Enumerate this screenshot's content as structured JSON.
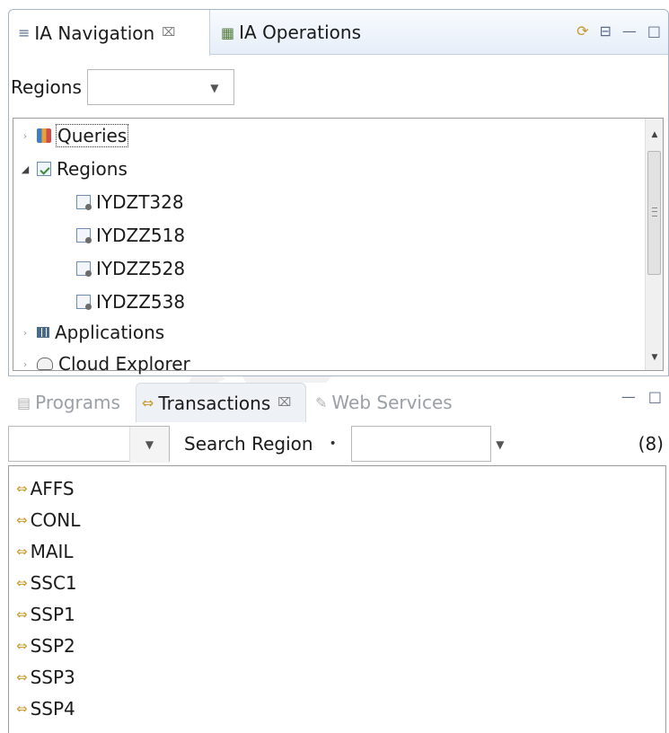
{
  "navigation_view": {
    "tabs": [
      {
        "label": "IA Navigation",
        "active": true
      },
      {
        "label": "IA Operations",
        "active": false
      }
    ],
    "filter_label": "Regions",
    "filter_value": "",
    "tree": [
      {
        "label": "Queries",
        "level": 0,
        "expanded": false,
        "icon": "queries-icon"
      },
      {
        "label": "Regions",
        "level": 0,
        "expanded": true,
        "icon": "regions-icon"
      },
      {
        "label": "IYDZT328",
        "level": 1,
        "icon": "region-icon"
      },
      {
        "label": "IYDZZ518",
        "level": 1,
        "icon": "region-icon"
      },
      {
        "label": "IYDZZ528",
        "level": 1,
        "icon": "region-icon"
      },
      {
        "label": "IYDZZ538",
        "level": 1,
        "icon": "region-icon"
      },
      {
        "label": "Applications",
        "level": 0,
        "expanded": false,
        "icon": "applications-icon"
      },
      {
        "label": "Cloud Explorer",
        "level": 0,
        "expanded": false,
        "icon": "cloud-icon"
      }
    ]
  },
  "transactions_view": {
    "tabs": [
      {
        "label": "Programs",
        "active": false
      },
      {
        "label": "Transactions",
        "active": true
      },
      {
        "label": "Web Services",
        "active": false
      }
    ],
    "search_label": "Search Region",
    "count": "(8)",
    "items": [
      "AFFS",
      "CONL",
      "MAIL",
      "SSC1",
      "SSP1",
      "SSP2",
      "SSP3",
      "SSP4"
    ]
  },
  "watermark_text": "Archive",
  "colors": {
    "tab_border": "#a7b4c6",
    "transaction_icon": "#c89a2a",
    "inactive_tab_text": "#9aa0a6"
  }
}
